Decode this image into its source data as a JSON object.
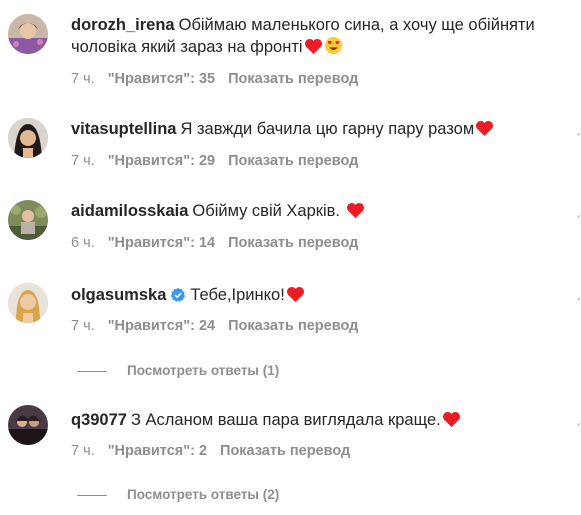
{
  "comments": [
    {
      "username": "dorozh_irena",
      "text": "Обіймаю маленького сина, а хочу ще обійняти чоловіка який зараз на фронті",
      "emojis": [
        "red-heart",
        "heart-eyes"
      ],
      "verified": false,
      "time": "7 ч.",
      "likes": "\"Нравится\": 35",
      "translate": "Показать перевод"
    },
    {
      "username": "vitasuptellina",
      "text": "Я завжди бачила цю гарну пару разом",
      "emojis": [
        "red-heart"
      ],
      "verified": false,
      "time": "7 ч.",
      "likes": "\"Нравится\": 29",
      "translate": "Показать перевод"
    },
    {
      "username": "aidamilosskaia",
      "text": "Обійму свій Харків.",
      "emojis": [
        "red-heart"
      ],
      "verified": false,
      "time": "6 ч.",
      "likes": "\"Нравится\": 14",
      "translate": "Показать перевод"
    },
    {
      "username": "olgasumska",
      "text": "Тебе,Іринко!",
      "emojis": [
        "red-heart"
      ],
      "verified": true,
      "time": "7 ч.",
      "likes": "\"Нравится\": 24",
      "translate": "Показать перевод",
      "view_replies": "Посмотреть ответы (1)"
    },
    {
      "username": "q39077",
      "text": "З Асланом ваша пара виглядала краще.",
      "emojis": [
        "red-heart"
      ],
      "verified": false,
      "time": "7 ч.",
      "likes": "\"Нравится\": 2",
      "translate": "Показать перевод",
      "view_replies": "Посмотреть ответы (2)"
    }
  ],
  "colors": {
    "text": "#262626",
    "muted": "#8e8e8e",
    "heart": "#ed1c24",
    "verified": "#3897f0"
  }
}
